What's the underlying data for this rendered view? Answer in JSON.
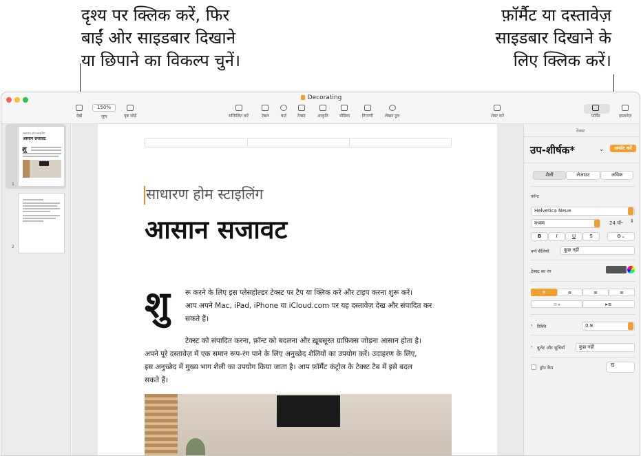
{
  "callouts": {
    "left": [
      "दृश्य पर क्लिक करें, फिर",
      "बाईं ओर साइडबार दिखाने",
      "या छिपाने का विकल्प चुनें।"
    ],
    "right": [
      "फ़ॉर्मैट या दस्तावेज़",
      "साइडबार दिखाने के",
      "लिए क्लिक करें।"
    ]
  },
  "window": {
    "title": "Decorating",
    "colors": {
      "close": "#fe5f57",
      "minimize": "#febc2e",
      "zoom": "#28c840",
      "accent": "#f0a030"
    }
  },
  "toolbar": {
    "view": "देखें",
    "zoom_value": "150%",
    "zoom": "ज़ूम",
    "add_page": "पृष्ठ जोड़ें",
    "insert": "सम्मिलित करें",
    "table": "टेबल",
    "chart": "चार्ट",
    "text": "टेक्स्ट",
    "shape": "आकृति",
    "media": "मीडिया",
    "comment": "टिप्पणी",
    "pen": "लेखन टूल",
    "share": "शेयर करें",
    "format": "फ़ॉर्मैट",
    "document": "दस्तावेज़"
  },
  "thumbnails": {
    "pages": [
      {
        "number": "1",
        "heading": "आसान सजावट",
        "sub": "साधारण होम स्टाइलिंग",
        "letter": "शु"
      },
      {
        "number": "2"
      }
    ]
  },
  "document": {
    "subtitle": "साधारण होम स्टाइलिंग",
    "title": "आसान सजावट",
    "dropcap": "शु",
    "para1": [
      "रू करने के लिए इस प्लेसहोल्डर टेक्स्ट पर टैप या क्लिक करें और टाइप करना शुरू करें।",
      "आप अपने Mac, iPad, iPhone या iCloud.com पर यह दस्तावेज़ देख और संपादित कर",
      "सकते हैं।"
    ],
    "para2_first": "टेक्स्ट को संपादित करना, फ़ॉन्ट को बदलना और ख़ूबसूरत ग्राफ़िक्स जोड़ना आसान होता है।",
    "para2_rest": [
      "अपने पूरे दस्तावेज़ में एक समान रूप-रंग पाने के लिए अनुच्छेद शैलियों का उपयोग करें। उदाहरण के लिए,",
      "इस अनुच्छेद में मुख्य भाग शैली का उपयोग किया जाता है। आप फ़ॉर्मैट कंट्रोल के टेक्स्ट टैब में इसे बदल",
      "सकते हैं।"
    ]
  },
  "sidebar": {
    "header": "टेक्स्ट",
    "style_name": "उप-शीर्षक*",
    "update_button": "अपडेट करें",
    "tabs": [
      "शैली",
      "लेआउट",
      "अधिक"
    ],
    "font_label": "फ़ॉन्ट",
    "font_name": "Helvetica Neue",
    "font_weight": "मध्यम",
    "font_size": "24 पॉ॰",
    "bold": "B",
    "italic": "I",
    "underline": "U",
    "strikethrough": "S",
    "char_styles_label": "वर्ण शैलियाँ",
    "char_styles_value": "कुछ नहीं",
    "text_color_label": "टेक्स्ट का रंग",
    "spacing_label": "रिक्ति",
    "spacing_value": "0.9",
    "bullets_label": "बुलेट और सूचियाँ",
    "bullets_value": "कुछ नहीं",
    "dropcap_label": "ड्रॉप कैप",
    "dropcap_glyph": "य"
  }
}
